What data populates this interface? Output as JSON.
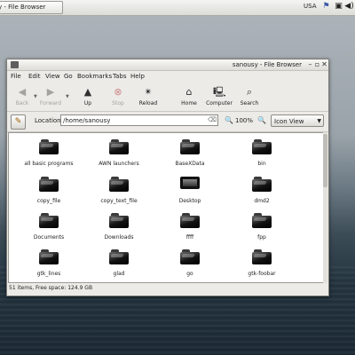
{
  "panel": {
    "task_label": "y - File Browser",
    "keyboard_layout": "USA"
  },
  "window": {
    "title": "sanousy - File Browser"
  },
  "menu": [
    "File",
    "Edit",
    "View",
    "Go",
    "Bookmarks",
    "Tabs",
    "Help"
  ],
  "toolbar": {
    "back": "Back",
    "forward": "Forward",
    "up": "Up",
    "stop": "Stop",
    "reload": "Reload",
    "home": "Home",
    "computer": "Computer",
    "search": "Search"
  },
  "location": {
    "label": "Location:",
    "value": "/home/sanousy",
    "zoom": "100%",
    "view_mode": "Icon View"
  },
  "files": [
    {
      "name": "all basic programs",
      "icon": "folder-icon"
    },
    {
      "name": "AWN launchers",
      "icon": "folder-icon"
    },
    {
      "name": "BaseXData",
      "icon": "folder-icon"
    },
    {
      "name": "bin",
      "icon": "folder-icon"
    },
    {
      "name": "copy_file",
      "icon": "folder-icon"
    },
    {
      "name": "copy_text_file",
      "icon": "folder-icon"
    },
    {
      "name": "Desktop",
      "icon": "desktop-icon"
    },
    {
      "name": "dmd2",
      "icon": "folder-icon"
    },
    {
      "name": "Documents",
      "icon": "folder-icon"
    },
    {
      "name": "Downloads",
      "icon": "downloads-folder-icon"
    },
    {
      "name": "ffff",
      "icon": "folder-icon"
    },
    {
      "name": "fpp",
      "icon": "folder-icon"
    },
    {
      "name": "gtk_lines",
      "icon": "folder-icon"
    },
    {
      "name": "glad",
      "icon": "folder-icon"
    },
    {
      "name": "go",
      "icon": "folder-icon"
    },
    {
      "name": "gtk-foobar",
      "icon": "folder-icon"
    }
  ],
  "status": "51 items, Free space: 124.9 GB"
}
